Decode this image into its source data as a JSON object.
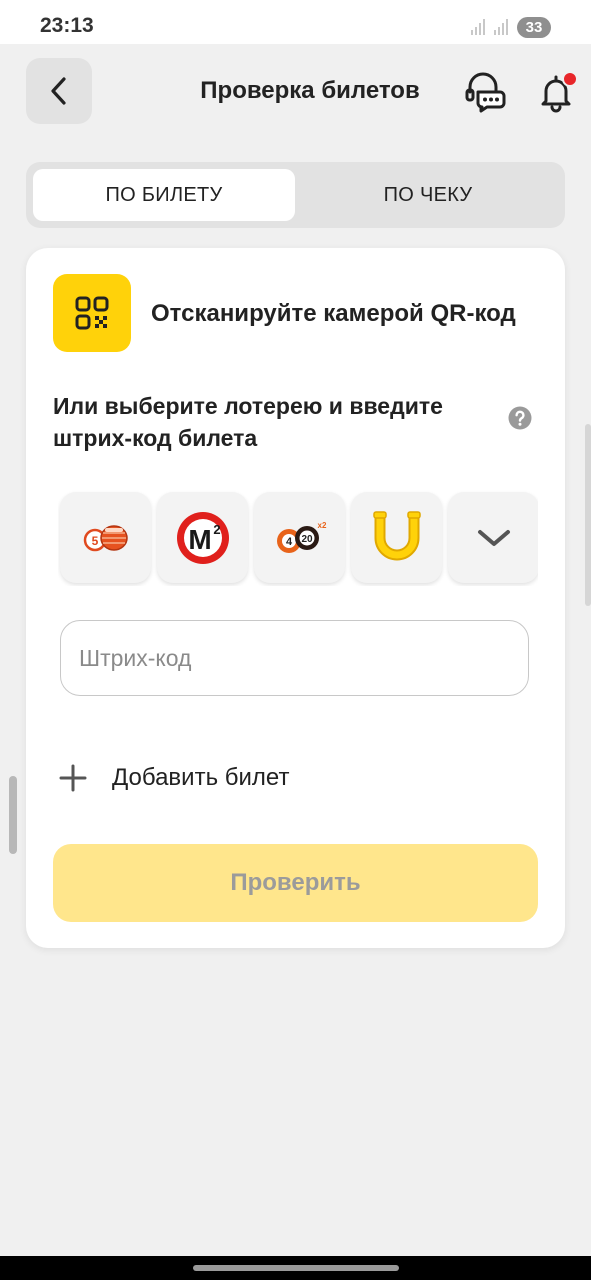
{
  "status_bar": {
    "time": "23:13",
    "battery": "33"
  },
  "header": {
    "title": "Проверка билетов",
    "back_icon": "chevron-left-icon",
    "support_icon": "support-chat-icon",
    "notifications_icon": "bell-icon",
    "notification_dot_color": "#e8262a"
  },
  "tabs": [
    {
      "label": "ПО БИЛЕТУ",
      "active": true
    },
    {
      "label": "ПО ЧЕКУ",
      "active": false
    }
  ],
  "card": {
    "qr_text": "Отсканируйте камерой QR-код",
    "select_text": "Или выберите лотерею и введите штрих-код билета",
    "lotteries": [
      {
        "name": "bingo-lottery-icon"
      },
      {
        "name": "m2-lottery-icon",
        "logo_text": "M²"
      },
      {
        "name": "four-of-twenty-lottery-icon",
        "logo_text": "4 20 x2"
      },
      {
        "name": "horseshoe-lottery-icon"
      },
      {
        "name": "more-lotteries-chevron-icon"
      }
    ],
    "barcode_placeholder": "Штрих-код",
    "add_ticket": "Добавить билет",
    "check_button": "Проверить"
  },
  "colors": {
    "accent_yellow": "#ffd20a",
    "button_disabled": "#ffe68c",
    "background": "#f0f0f0"
  }
}
